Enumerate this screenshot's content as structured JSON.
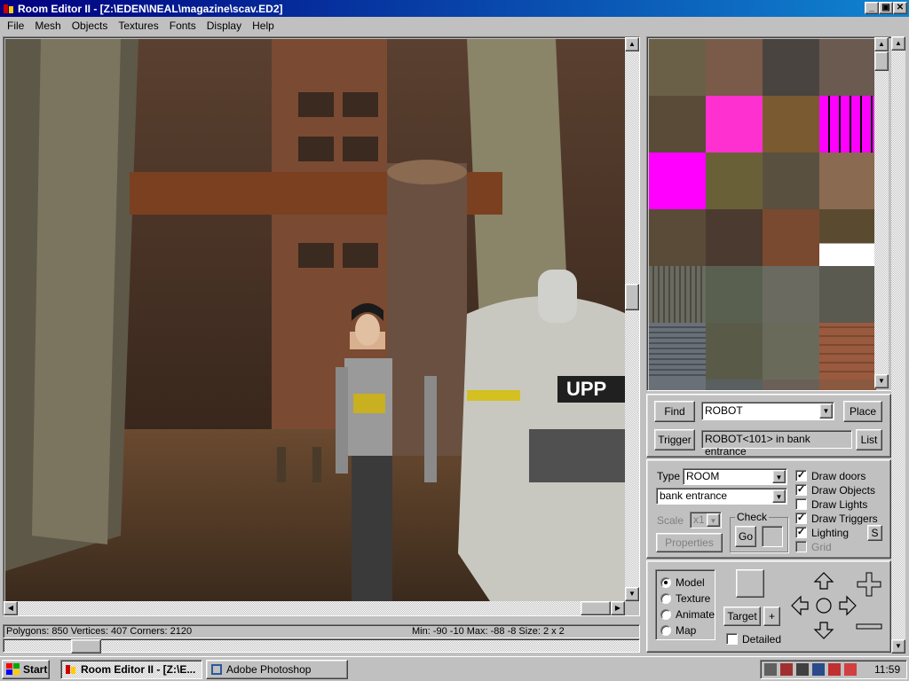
{
  "window": {
    "title": "Room Editor II - [Z:\\EDEN\\NEAL\\magazine\\scav.ED2]",
    "minimize_icon": "minimize-icon",
    "restore_icon": "restore-icon",
    "close_icon": "close-icon"
  },
  "menu": [
    "File",
    "Mesh",
    "Objects",
    "Textures",
    "Fonts",
    "Display",
    "Help"
  ],
  "viewport": {
    "sign_text": "UPP"
  },
  "status": {
    "left": "Polygons: 850  Vertices: 407  Corners: 2120",
    "right": "Min: -90 -10  Max: -88 -8  Size: 2 x 2"
  },
  "find_panel": {
    "find_label": "Find",
    "find_value": "ROBOT",
    "place_label": "Place",
    "trigger_label": "Trigger",
    "trigger_value": "ROBOT<101> in bank entrance",
    "list_label": "List"
  },
  "room_panel": {
    "type_label": "Type",
    "type_value": "ROOM",
    "room_value": "bank entrance",
    "scale_label": "Scale",
    "scale_value": "x1",
    "properties_label": "Properties",
    "check_label": "Check",
    "go_label": "Go",
    "checkboxes": [
      {
        "label": "Draw doors",
        "checked": true
      },
      {
        "label": "Draw Objects",
        "checked": true
      },
      {
        "label": "Draw Lights",
        "checked": false
      },
      {
        "label": "Draw Triggers",
        "checked": true
      },
      {
        "label": "Lighting",
        "checked": true
      },
      {
        "label": "Grid",
        "checked": false
      }
    ],
    "s_button": "S"
  },
  "mode_panel": {
    "modes": [
      "Model",
      "Texture",
      "Animate",
      "Map"
    ],
    "selected_mode": "Model",
    "target_label": "Target",
    "plus_label": "+",
    "detailed_label": "Detailed"
  },
  "taskbar": {
    "start_label": "Start",
    "tasks": [
      "Room Editor II - [Z:\\E...",
      "Adobe Photoshop"
    ],
    "clock": "11:59"
  }
}
